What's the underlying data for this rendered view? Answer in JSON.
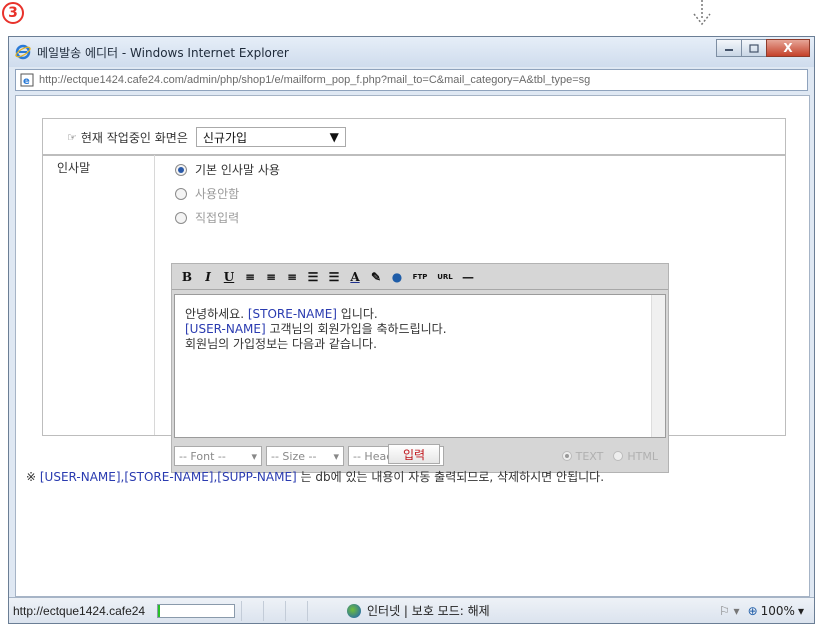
{
  "step_badge": "3",
  "window": {
    "title": "메일발송 에디터 - Windows Internet Explorer",
    "close_label": "X",
    "url": "http://ectque1424.cafe24.com/admin/php/shop1/e/mailform_pop_f.php?mail_to=C&mail_category=A&tbl_type=sg"
  },
  "form": {
    "screen_label": "현재 작업중인 화면은",
    "screen_value": "신규가입",
    "greeting_label": "인사말",
    "radio_options": [
      "기본 인사말 사용",
      "사용안함",
      "직접입력"
    ],
    "selected_radio": 0
  },
  "editor": {
    "toolbar_icons": [
      "bold-icon",
      "italic-icon",
      "underline-icon",
      "align-left-icon",
      "align-center-icon",
      "align-right-icon",
      "ordered-list-icon",
      "unordered-list-icon",
      "font-color-icon",
      "highlight-icon",
      "link-icon",
      "image-ftp-icon",
      "image-url-icon",
      "horizontal-rule-icon"
    ],
    "toolbar_labels": [
      "B",
      "I",
      "U",
      "≡",
      "≡",
      "≡",
      "☰",
      "☰",
      "A",
      "✎",
      "●",
      "FTP",
      "URL",
      "—"
    ],
    "line1_pre": "안녕하세요. ",
    "line1_tag": "[STORE-NAME]",
    "line1_post": " 입니다.",
    "line2_tag": "[USER-NAME]",
    "line2_post": " 고객님의 회원가입을 축하드립니다.",
    "line3": "회원님의 가입정보는 다음과 같습니다.",
    "font_select": "-- Font --",
    "size_select": "-- Size --",
    "heading_select": "-- Heading --",
    "mode_text": "TEXT",
    "mode_html": "HTML"
  },
  "submit_label": "입력",
  "notice": {
    "prefix": "※ ",
    "tags": "[USER-NAME],[STORE-NAME],[SUPP-NAME]",
    "suffix": " 는 db에 있는 내용이 자동 출력되므로, 삭제하시면 안됩니다."
  },
  "status": {
    "url": "http://ectque1424.cafe24",
    "progress": 0.03,
    "zone_text": "인터넷 | 보호 모드: 해제",
    "zoom": "100%"
  },
  "colors": {
    "tag_blue": "#2a3bb0",
    "submit_red": "#c0161c",
    "step_red": "#e8322b"
  }
}
